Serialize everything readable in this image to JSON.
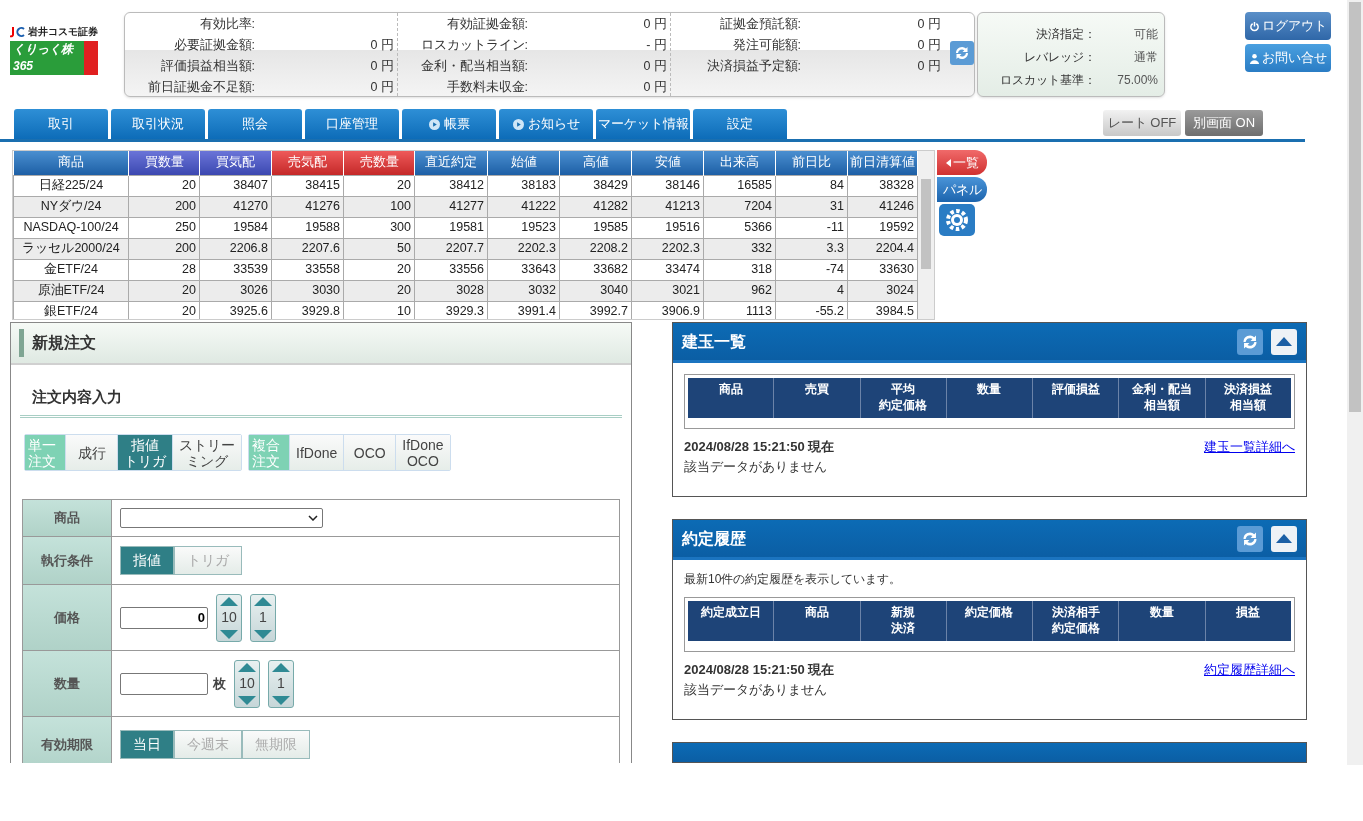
{
  "logo": {
    "company": "岩井コスモ証券",
    "product": "くりっく株365"
  },
  "summary": {
    "columns": [
      {
        "items": [
          {
            "label": "有効比率:",
            "value": ""
          },
          {
            "label": "必要証拠金額:",
            "value": "0 円"
          },
          {
            "label": "評価損益相当額:",
            "value": "0 円"
          },
          {
            "label": "前日証拠金不足額:",
            "value": "0 円"
          }
        ]
      },
      {
        "items": [
          {
            "label": "有効証拠金額:",
            "value": "0 円"
          },
          {
            "label": "ロスカットライン:",
            "value": "- 円"
          },
          {
            "label": "金利・配当相当額:",
            "value": "0 円"
          },
          {
            "label": "手数料未収金:",
            "value": "0 円"
          }
        ]
      },
      {
        "items": [
          {
            "label": "証拠金預託額:",
            "value": "0 円"
          },
          {
            "label": "発注可能額:",
            "value": "0 円"
          },
          {
            "label": "決済損益予定額:",
            "value": "0 円"
          }
        ]
      }
    ]
  },
  "status": [
    {
      "label": "決済指定：",
      "value": "可能"
    },
    {
      "label": "レバレッジ：",
      "value": "通常"
    },
    {
      "label": "ロスカット基準：",
      "value": "75.00%"
    }
  ],
  "header_buttons": [
    {
      "label": "ログアウト",
      "kind": "logout"
    },
    {
      "label": "お問い合せ",
      "kind": "contact"
    }
  ],
  "nav_tabs": [
    {
      "label": "取引",
      "kind": "plain"
    },
    {
      "label": "取引状況",
      "kind": "plain"
    },
    {
      "label": "照会",
      "kind": "plain"
    },
    {
      "label": "口座管理",
      "kind": "plain"
    },
    {
      "label": "帳票",
      "kind": "menu"
    },
    {
      "label": "お知らせ",
      "kind": "menu"
    },
    {
      "label": "マーケット情報",
      "kind": "plain"
    },
    {
      "label": "設定",
      "kind": "plain"
    }
  ],
  "toggles": [
    {
      "label": "レート OFF",
      "on": false
    },
    {
      "label": "別画面 ON",
      "on": true
    }
  ],
  "rates": {
    "columns": [
      {
        "label": "商品",
        "kind": "name"
      },
      {
        "label": "買数量",
        "kind": "buy"
      },
      {
        "label": "買気配",
        "kind": "buy"
      },
      {
        "label": "売気配",
        "kind": "sell"
      },
      {
        "label": "売数量",
        "kind": "sell"
      },
      {
        "label": "直近約定",
        "kind": "other"
      },
      {
        "label": "始値",
        "kind": "other"
      },
      {
        "label": "高値",
        "kind": "other"
      },
      {
        "label": "安値",
        "kind": "other"
      },
      {
        "label": "出来高",
        "kind": "other"
      },
      {
        "label": "前日比",
        "kind": "other"
      },
      {
        "label": "前日清算値",
        "kind": "other"
      }
    ],
    "rows": [
      [
        "日経225/24",
        "20",
        "38407",
        "38415",
        "20",
        "38412",
        "38183",
        "38429",
        "38146",
        "16585",
        "84",
        "38328"
      ],
      [
        "NYダウ/24",
        "200",
        "41270",
        "41276",
        "100",
        "41277",
        "41222",
        "41282",
        "41213",
        "7204",
        "31",
        "41246"
      ],
      [
        "NASDAQ-100/24",
        "250",
        "19584",
        "19588",
        "300",
        "19581",
        "19523",
        "19585",
        "19516",
        "5366",
        "-11",
        "19592"
      ],
      [
        "ラッセル2000/24",
        "200",
        "2206.8",
        "2207.6",
        "50",
        "2207.7",
        "2202.3",
        "2208.2",
        "2202.3",
        "332",
        "3.3",
        "2204.4"
      ],
      [
        "金ETF/24",
        "28",
        "33539",
        "33558",
        "20",
        "33556",
        "33643",
        "33682",
        "33474",
        "318",
        "-74",
        "33630"
      ],
      [
        "原油ETF/24",
        "20",
        "3026",
        "3030",
        "20",
        "3028",
        "3032",
        "3040",
        "3021",
        "962",
        "4",
        "3024"
      ],
      [
        "銀ETF/24",
        "20",
        "3925.6",
        "3929.8",
        "10",
        "3929.3",
        "3991.4",
        "3992.7",
        "3906.9",
        "1113",
        "-55.2",
        "3984.5"
      ]
    ]
  },
  "side_tabs": [
    {
      "label": "一覧",
      "kind": "list"
    },
    {
      "label": "パネル",
      "kind": "panel"
    }
  ],
  "order": {
    "title": "新規注文",
    "section": "注文内容入力",
    "order_types": [
      {
        "group": [
          "単一",
          "注文"
        ],
        "options": [
          {
            "lines": [
              "成行"
            ],
            "selected": false
          },
          {
            "lines": [
              "指値",
              "トリガ"
            ],
            "selected": true
          },
          {
            "lines": [
              "ストリー",
              "ミング"
            ],
            "selected": false
          }
        ]
      },
      {
        "group": [
          "複合",
          "注文"
        ],
        "options": [
          {
            "lines": [
              "IfDone"
            ],
            "selected": false
          },
          {
            "lines": [
              "OCO"
            ],
            "selected": false
          },
          {
            "lines": [
              "IfDone",
              "OCO"
            ],
            "selected": false
          }
        ]
      }
    ],
    "fields": [
      {
        "label": "商品",
        "kind": "select"
      },
      {
        "label": "執行条件",
        "kind": "toggle",
        "options": [
          {
            "label": "指値",
            "selected": true
          },
          {
            "label": "トリガ",
            "selected": false
          }
        ]
      },
      {
        "label": "価格",
        "kind": "stepper",
        "value": "0",
        "steps": [
          "10",
          "1"
        ]
      },
      {
        "label": "数量",
        "kind": "stepper",
        "unit": "枚",
        "steps": [
          "10",
          "1"
        ]
      },
      {
        "label": "有効期限",
        "kind": "toggle",
        "options": [
          {
            "label": "当日",
            "selected": true
          },
          {
            "label": "今週末",
            "selected": false
          },
          {
            "label": "無期限",
            "selected": false
          }
        ]
      }
    ]
  },
  "panels": [
    {
      "title": "建玉一覧",
      "columns": [
        [
          "商品"
        ],
        [
          "売買"
        ],
        [
          "平均",
          "約定価格"
        ],
        [
          "数量"
        ],
        [
          "評価損益"
        ],
        [
          "金利・配当",
          "相当額"
        ],
        [
          "決済損益",
          "相当額"
        ]
      ],
      "timestamp": "2024/08/28 15:21:50 現在",
      "empty_message": "該当データがありません",
      "link": "建玉一覧詳細へ"
    },
    {
      "title": "約定履歴",
      "note": "最新10件の約定履歴を表示しています。",
      "columns": [
        [
          "約定成立日"
        ],
        [
          "商品"
        ],
        [
          "新規",
          "決済"
        ],
        [
          "約定価格"
        ],
        [
          "決済相手",
          "約定価格"
        ],
        [
          "数量"
        ],
        [
          "損益"
        ]
      ],
      "timestamp": "2024/08/28 15:21:50 現在",
      "empty_message": "該当データがありません",
      "link": "約定履歴詳細へ"
    }
  ]
}
